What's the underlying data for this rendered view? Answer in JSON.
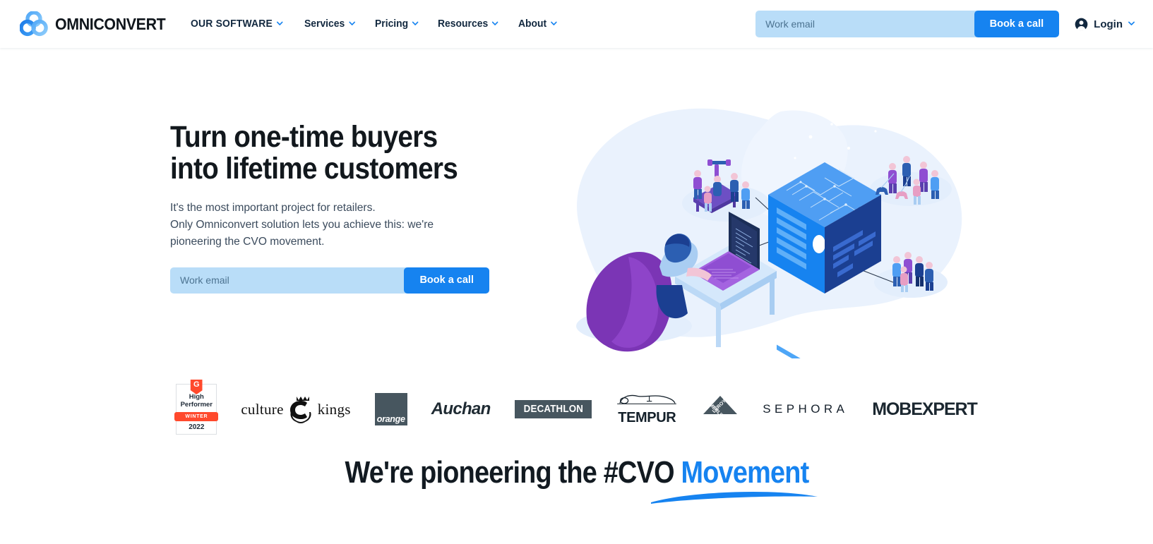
{
  "brand": {
    "name": "OMNICONVERT",
    "logo_icon": "omniconvert-rings-logo"
  },
  "nav": {
    "items": [
      {
        "label": "OUR SOFTWARE",
        "caret": "chevron-down-icon"
      },
      {
        "label": "Services",
        "caret": "chevron-down-icon"
      },
      {
        "label": "Pricing",
        "caret": "chevron-down-icon"
      },
      {
        "label": "Resources",
        "caret": "chevron-down-icon"
      },
      {
        "label": "About",
        "caret": "chevron-down-icon"
      }
    ]
  },
  "header": {
    "email_placeholder": "Work email",
    "email_value": "",
    "cta_label": "Book a call",
    "login_label": "Login",
    "login_icon": "account-circle-icon",
    "login_caret": "chevron-down-icon"
  },
  "hero": {
    "title": "Turn one-time buyers\ninto lifetime customers",
    "subtitle": "It's the most important project for retailers.\nOnly Omniconvert solution lets you achieve this: we're\npioneering the CVO movement.",
    "email_placeholder": "Work email",
    "email_value": "",
    "cta_label": "Book a call",
    "illustration_name": "isometric-cvo-data-cube-illustration"
  },
  "logos": {
    "g2": {
      "mark": "G",
      "line1": "High",
      "line2": "Performer",
      "ribbon": "WINTER",
      "year": "2022"
    },
    "items": [
      {
        "name": "culture-kings-logo",
        "left_text": "culture",
        "right_text": "kings",
        "crest_letter": "C"
      },
      {
        "name": "orange-logo",
        "text": "orange"
      },
      {
        "name": "auchan-logo",
        "text": "Auchan"
      },
      {
        "name": "decathlon-logo",
        "text": "DECATHLON"
      },
      {
        "name": "tempur-logo",
        "text": "TEMPUR"
      },
      {
        "name": "leroy-merlin-logo",
        "text_top": "LEROY",
        "text_bottom": "MERLIN"
      },
      {
        "name": "sephora-logo",
        "text": "SEPHORA"
      },
      {
        "name": "mobexpert-logo",
        "text": "MOBEXPERT"
      }
    ]
  },
  "bottom": {
    "headline_plain": "We're pioneering the #CVO ",
    "headline_accent": "Movement",
    "underline_icon": "blue-swoosh-underline"
  },
  "colors": {
    "accent_blue": "#1683f0",
    "light_blue_field": "#b9ddf8",
    "navy_text": "#12283f",
    "dark_text": "#12181d",
    "slate_logo": "#47565f",
    "g2_red": "#ff492c",
    "purple": "#7b35b5"
  }
}
